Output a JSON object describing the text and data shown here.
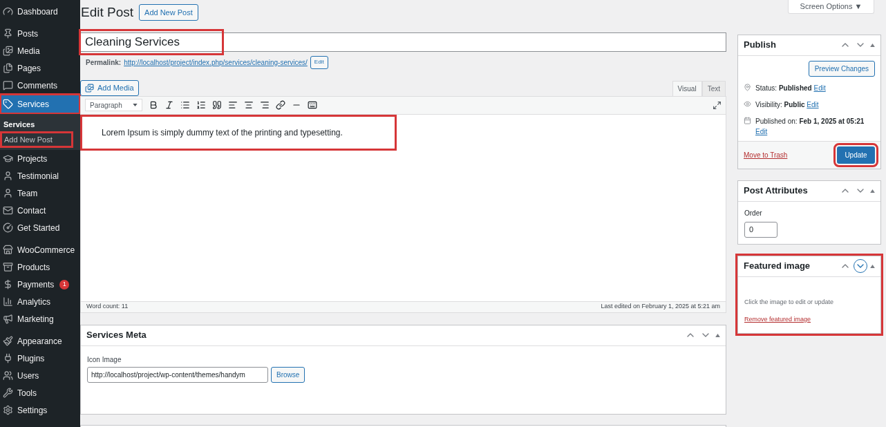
{
  "sidebar": {
    "sections": [
      [
        {
          "label": "Dashboard",
          "selected": false
        }
      ],
      [
        {
          "label": "Posts",
          "selected": false
        },
        {
          "label": "Media",
          "selected": false
        },
        {
          "label": "Pages",
          "selected": false
        },
        {
          "label": "Comments",
          "selected": false
        },
        {
          "label": "Services",
          "selected": true,
          "highlighted": true,
          "submenu": [
            {
              "label": "Services",
              "selected": true,
              "highlighted": false
            },
            {
              "label": "Add New Post",
              "selected": false,
              "highlighted": true
            }
          ]
        },
        {
          "label": "Projects",
          "selected": false
        },
        {
          "label": "Testimonial",
          "selected": false
        },
        {
          "label": "Team",
          "selected": false
        },
        {
          "label": "Contact",
          "selected": false
        },
        {
          "label": "Get Started",
          "selected": false
        }
      ],
      [
        {
          "label": "WooCommerce",
          "selected": false
        },
        {
          "label": "Products",
          "selected": false
        },
        {
          "label": "Payments",
          "selected": false,
          "badge": "1"
        },
        {
          "label": "Analytics",
          "selected": false
        },
        {
          "label": "Marketing",
          "selected": false
        }
      ],
      [
        {
          "label": "Appearance",
          "selected": false
        },
        {
          "label": "Plugins",
          "selected": false
        },
        {
          "label": "Users",
          "selected": false
        },
        {
          "label": "Tools",
          "selected": false
        },
        {
          "label": "Settings",
          "selected": false
        }
      ]
    ]
  },
  "header": {
    "title": "Edit Post",
    "add_new": "Add New Post",
    "screen_options": "Screen Options ▼"
  },
  "post": {
    "title": "Cleaning Services",
    "title_highlighted": true,
    "permalink_label": "Permalink:",
    "permalink": "http://localhost/project/index.php/services/cleaning-services/",
    "permalink_edit": "Edit"
  },
  "editor": {
    "add_media": "Add Media",
    "tabs": [
      {
        "label": "Visual",
        "selected": true
      },
      {
        "label": "Text",
        "selected": false
      }
    ],
    "format": "Paragraph",
    "content": "Lorem Ipsum is simply dummy text of the printing and typesetting.",
    "content_highlighted": true,
    "word_count": "Word count: 11",
    "last_edited": "Last edited on February 1, 2025 at 5:21 am"
  },
  "services_meta": {
    "title": "Services Meta",
    "field_label": "Icon Image",
    "field_value": "http://localhost/project/wp-content/themes/handym",
    "browse": "Browse"
  },
  "publish": {
    "title": "Publish",
    "preview": "Preview Changes",
    "rows": [
      {
        "label": "Status:",
        "value": "Published",
        "edit": "Edit"
      },
      {
        "label": "Visibility:",
        "value": "Public",
        "edit": "Edit"
      },
      {
        "label": "Published on:",
        "value": "Feb 1, 2025 at 05:21",
        "edit": "Edit"
      }
    ],
    "trash": "Move to Trash",
    "update": "Update",
    "update_highlighted": true
  },
  "post_attributes": {
    "title": "Post Attributes",
    "order_label": "Order",
    "order_value": "0"
  },
  "featured_image": {
    "title": "Featured image",
    "highlighted": true,
    "hint": "Click the image to edit or update",
    "remove": "Remove featured image"
  }
}
